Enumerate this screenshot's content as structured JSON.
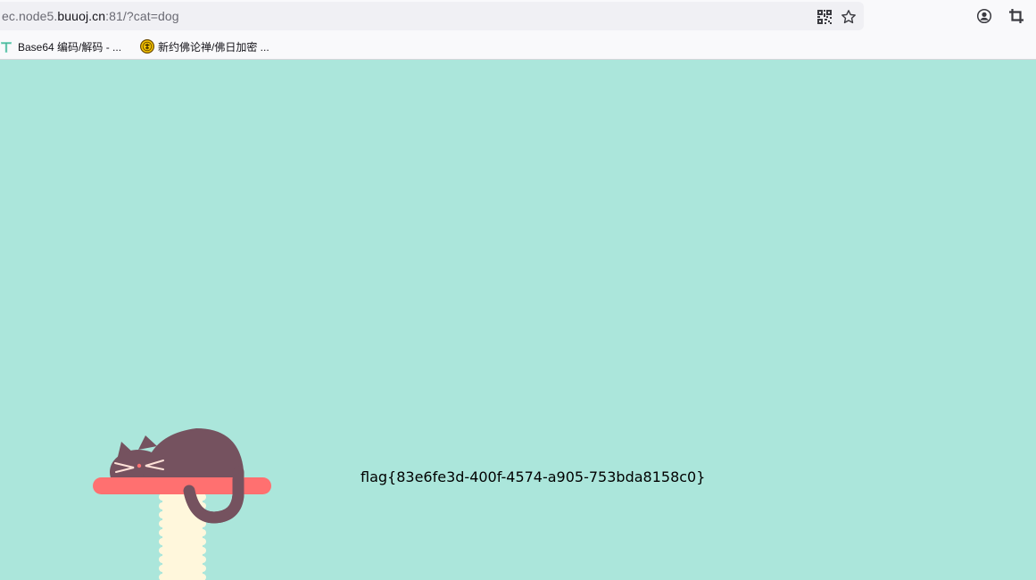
{
  "browser": {
    "url_prefix": "ec.node5.",
    "url_host": "buuoj.cn",
    "url_suffix": ":81/?cat=dog",
    "bookmarks": [
      {
        "label": "Base64 编码/解码 - ...",
        "icon": "t-logo-icon"
      },
      {
        "label": "新约佛论禅/佛日加密 ...",
        "icon": "buddha-coin-icon"
      }
    ],
    "toolbar_icons": [
      "qr-code-icon",
      "star-icon",
      "account-icon",
      "crop-icon"
    ]
  },
  "page": {
    "flag_text": "flag{83e6fe3d-400f-4574-a905-753bda8158c0}",
    "background_color": "#abe6db",
    "cat_color": "#75525f",
    "shelf_color": "#ff7070",
    "post_color": "#fff7dc"
  }
}
